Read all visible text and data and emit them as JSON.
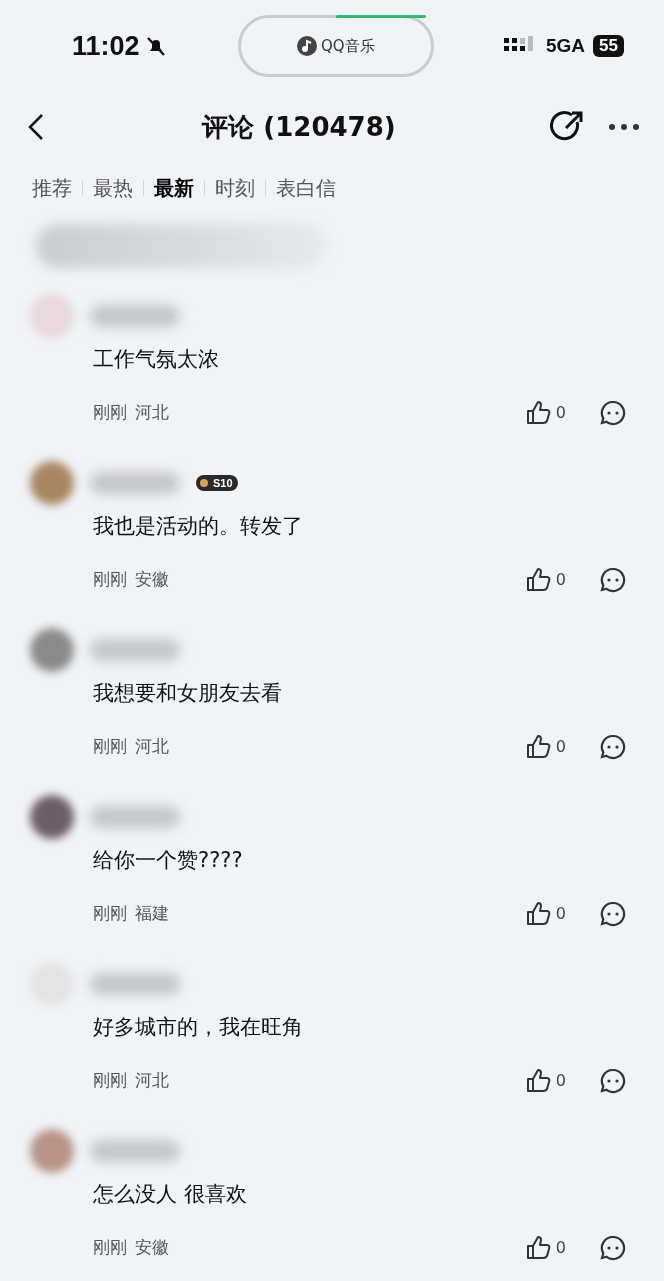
{
  "status_bar": {
    "time": "11:02",
    "island": "QQ音乐",
    "network": "5GA",
    "battery": "55"
  },
  "header": {
    "title": "评论 (120478)"
  },
  "tabs": [
    {
      "label": "推荐",
      "selected": false
    },
    {
      "label": "最热",
      "selected": false
    },
    {
      "label": "最新",
      "selected": true
    },
    {
      "label": "时刻",
      "selected": false
    },
    {
      "label": "表白信",
      "selected": false
    }
  ],
  "comments": [
    {
      "text": "工作气氛太浓",
      "time": "刚刚",
      "location": "河北",
      "likes": "0"
    },
    {
      "text": "我也是活动的。转发了",
      "time": "刚刚",
      "location": "安徽",
      "likes": "0",
      "badge": "S10"
    },
    {
      "text": "我想要和女朋友去看",
      "time": "刚刚",
      "location": "河北",
      "likes": "0"
    },
    {
      "text": "给你一个赞????",
      "time": "刚刚",
      "location": "福建",
      "likes": "0"
    },
    {
      "text": "好多城市的，我在旺角",
      "time": "刚刚",
      "location": "河北",
      "likes": "0"
    },
    {
      "text": "怎么没人 很喜欢",
      "time": "刚刚",
      "location": "安徽",
      "likes": "0"
    }
  ]
}
